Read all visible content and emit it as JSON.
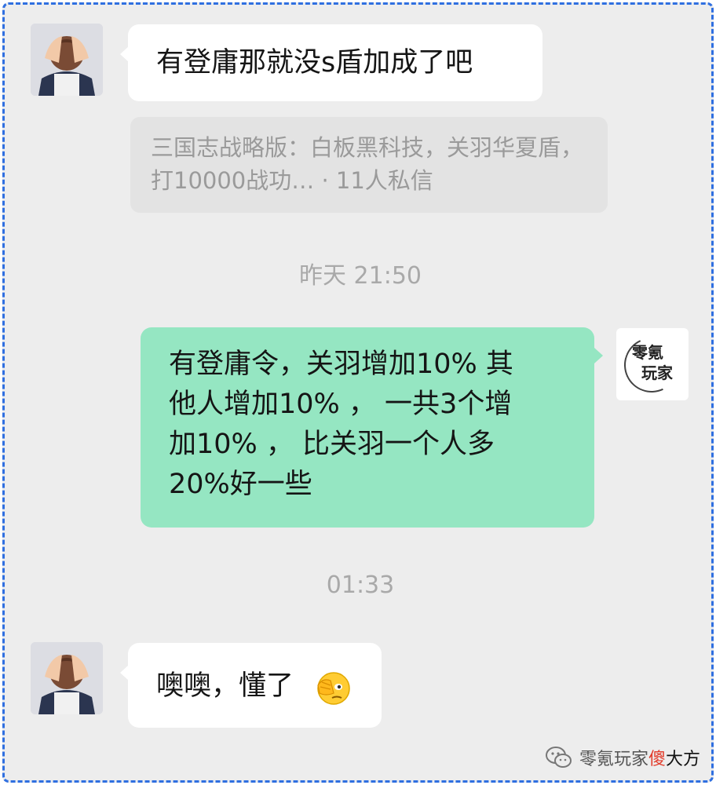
{
  "messages": {
    "first": "有登庸那就没s盾加成了吧",
    "quote": "三国志战略版：白板黑科技，关羽华夏盾，打10000战功… · 11人私信",
    "time1": "昨天 21:50",
    "reply_lines": [
      "有登庸令，关羽增加10% 其",
      "他人增加10% ， 一共3个增",
      "加10% ， 比关羽一个人多",
      "20%好一些"
    ],
    "time2": "01:33",
    "last": "噢噢，懂了"
  },
  "brand_avatar": {
    "line1": "零氪",
    "line2": "玩家"
  },
  "watermark": {
    "prefix": "零氪玩家",
    "highlight": "傻",
    "suffix": "大方"
  },
  "colors": {
    "frame_border": "#2f6fe0",
    "background": "#ededed",
    "self_bubble": "#95e6c2",
    "other_bubble": "#ffffff",
    "quote_bg": "#e3e3e3"
  }
}
